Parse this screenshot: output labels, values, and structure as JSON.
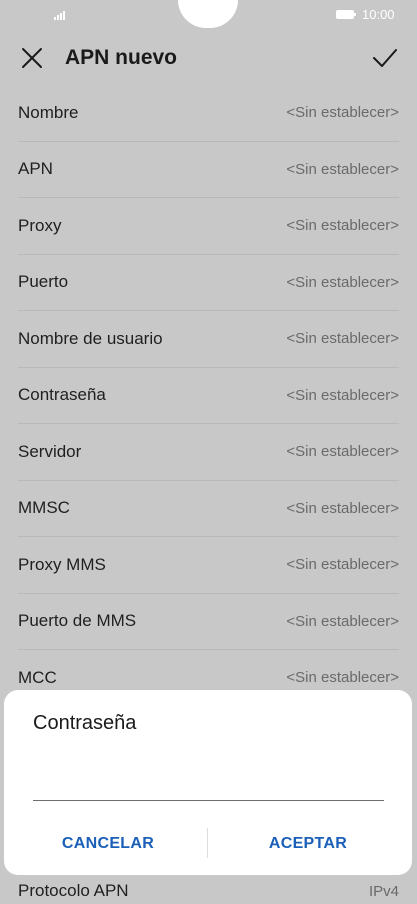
{
  "status_bar": {
    "time": "10:00",
    "signal_icon": "signal-icon",
    "battery_icon": "battery-icon"
  },
  "app_bar": {
    "title": "APN nuevo",
    "close_icon": "close-icon",
    "confirm_icon": "check-icon"
  },
  "settings": [
    {
      "label": "Nombre",
      "value": "<Sin establecer>"
    },
    {
      "label": "APN",
      "value": "<Sin establecer>"
    },
    {
      "label": "Proxy",
      "value": "<Sin establecer>"
    },
    {
      "label": "Puerto",
      "value": "<Sin establecer>"
    },
    {
      "label": "Nombre de usuario",
      "value": "<Sin establecer>"
    },
    {
      "label": "Contraseña",
      "value": "<Sin establecer>"
    },
    {
      "label": "Servidor",
      "value": "<Sin establecer>"
    },
    {
      "label": "MMSC",
      "value": "<Sin establecer>"
    },
    {
      "label": "Proxy MMS",
      "value": "<Sin establecer>"
    },
    {
      "label": "Puerto de MMS",
      "value": "<Sin establecer>"
    },
    {
      "label": "MCC",
      "value": "<Sin establecer>"
    }
  ],
  "bottom_row": {
    "label": "Protocolo APN",
    "value": "IPv4"
  },
  "dialog": {
    "title": "Contraseña",
    "input_value": "",
    "cancel_label": "CANCELAR",
    "ok_label": "ACEPTAR"
  },
  "colors": {
    "accent": "#1a5fb8",
    "scrim_background": "#c8c8c8",
    "dialog": "#ffffff"
  }
}
